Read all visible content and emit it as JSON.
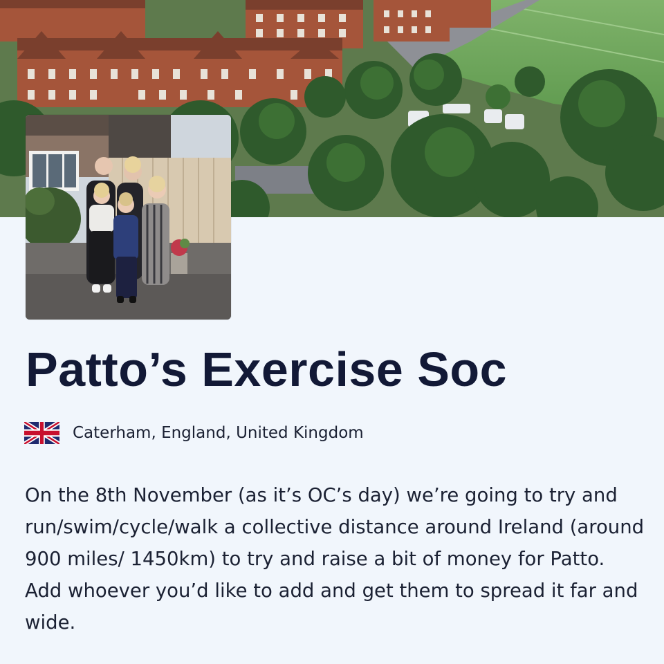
{
  "cover_image": {
    "description": "Aerial photo of red-brick school buildings with green playing fields and trees",
    "icon": "cover-photo"
  },
  "profile_photo": {
    "description": "Family of five standing in front of a wooden fence and house",
    "icon": "profile-photo"
  },
  "page": {
    "title": "Patto’s Exercise Soc",
    "location": {
      "flag_icon": "uk-flag-icon",
      "text": "Caterham, England, United Kingdom"
    },
    "description": "On the 8th November (as it’s OC’s day) we’re going to try and run/swim/cycle/walk a collective distance around Ireland (around 900 miles/ 1450km) to try and raise a bit of money for Patto. Add whoever you’d like to add and get them to spread it far and wide."
  },
  "colors": {
    "background": "#f1f6fc",
    "title": "#121936",
    "body_text": "#1b2133"
  }
}
